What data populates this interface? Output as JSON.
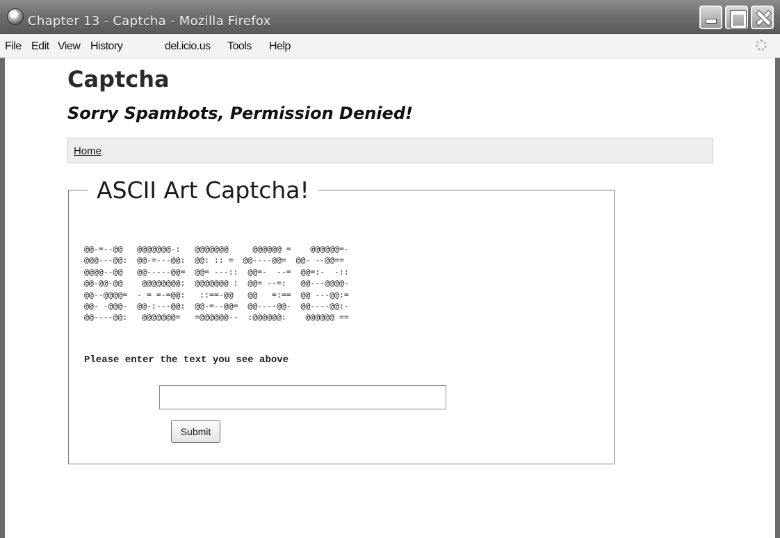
{
  "window": {
    "title": "Chapter 13 - Captcha - Mozilla Firefox"
  },
  "menubar": {
    "items": [
      "File",
      "Edit",
      "View",
      "History",
      "del.icio.us",
      "Tools",
      "Help"
    ]
  },
  "page": {
    "site_title": "Captcha",
    "tagline": "Sorry Spambots, Permission Denied!",
    "nav": {
      "home": "Home"
    },
    "captcha": {
      "legend": "ASCII Art Captcha!",
      "ascii_art": "@@-=--@@   @@@@@@@-:   @@@@@@@     @@@@@@ =    @@@@@@=-\n@@@---@@:  @@-=---@@:  @@: :: =  @@----@@=  @@- --@@==\n@@@@--@@   @@-----@@=  @@= ---::  @@=-  --=  @@=:-  -::\n@@-@@-@@    @@@@@@@@:  @@@@@@@ :  @@= --=:   @@---@@@@-\n@@--@@@@=  - = =-=@@:   ::==-@@   @@   =:==  @@ ---@@:=\n@@- -@@@-  @@-:---@@:  @@-=--@@=  @@----@@-  @@----@@:-\n@@----@@:   @@@@@@@=   =@@@@@@--  :@@@@@@:    @@@@@@ ==",
      "prompt": "Please enter the text you see above",
      "input_value": "",
      "submit_label": "Submit"
    }
  }
}
